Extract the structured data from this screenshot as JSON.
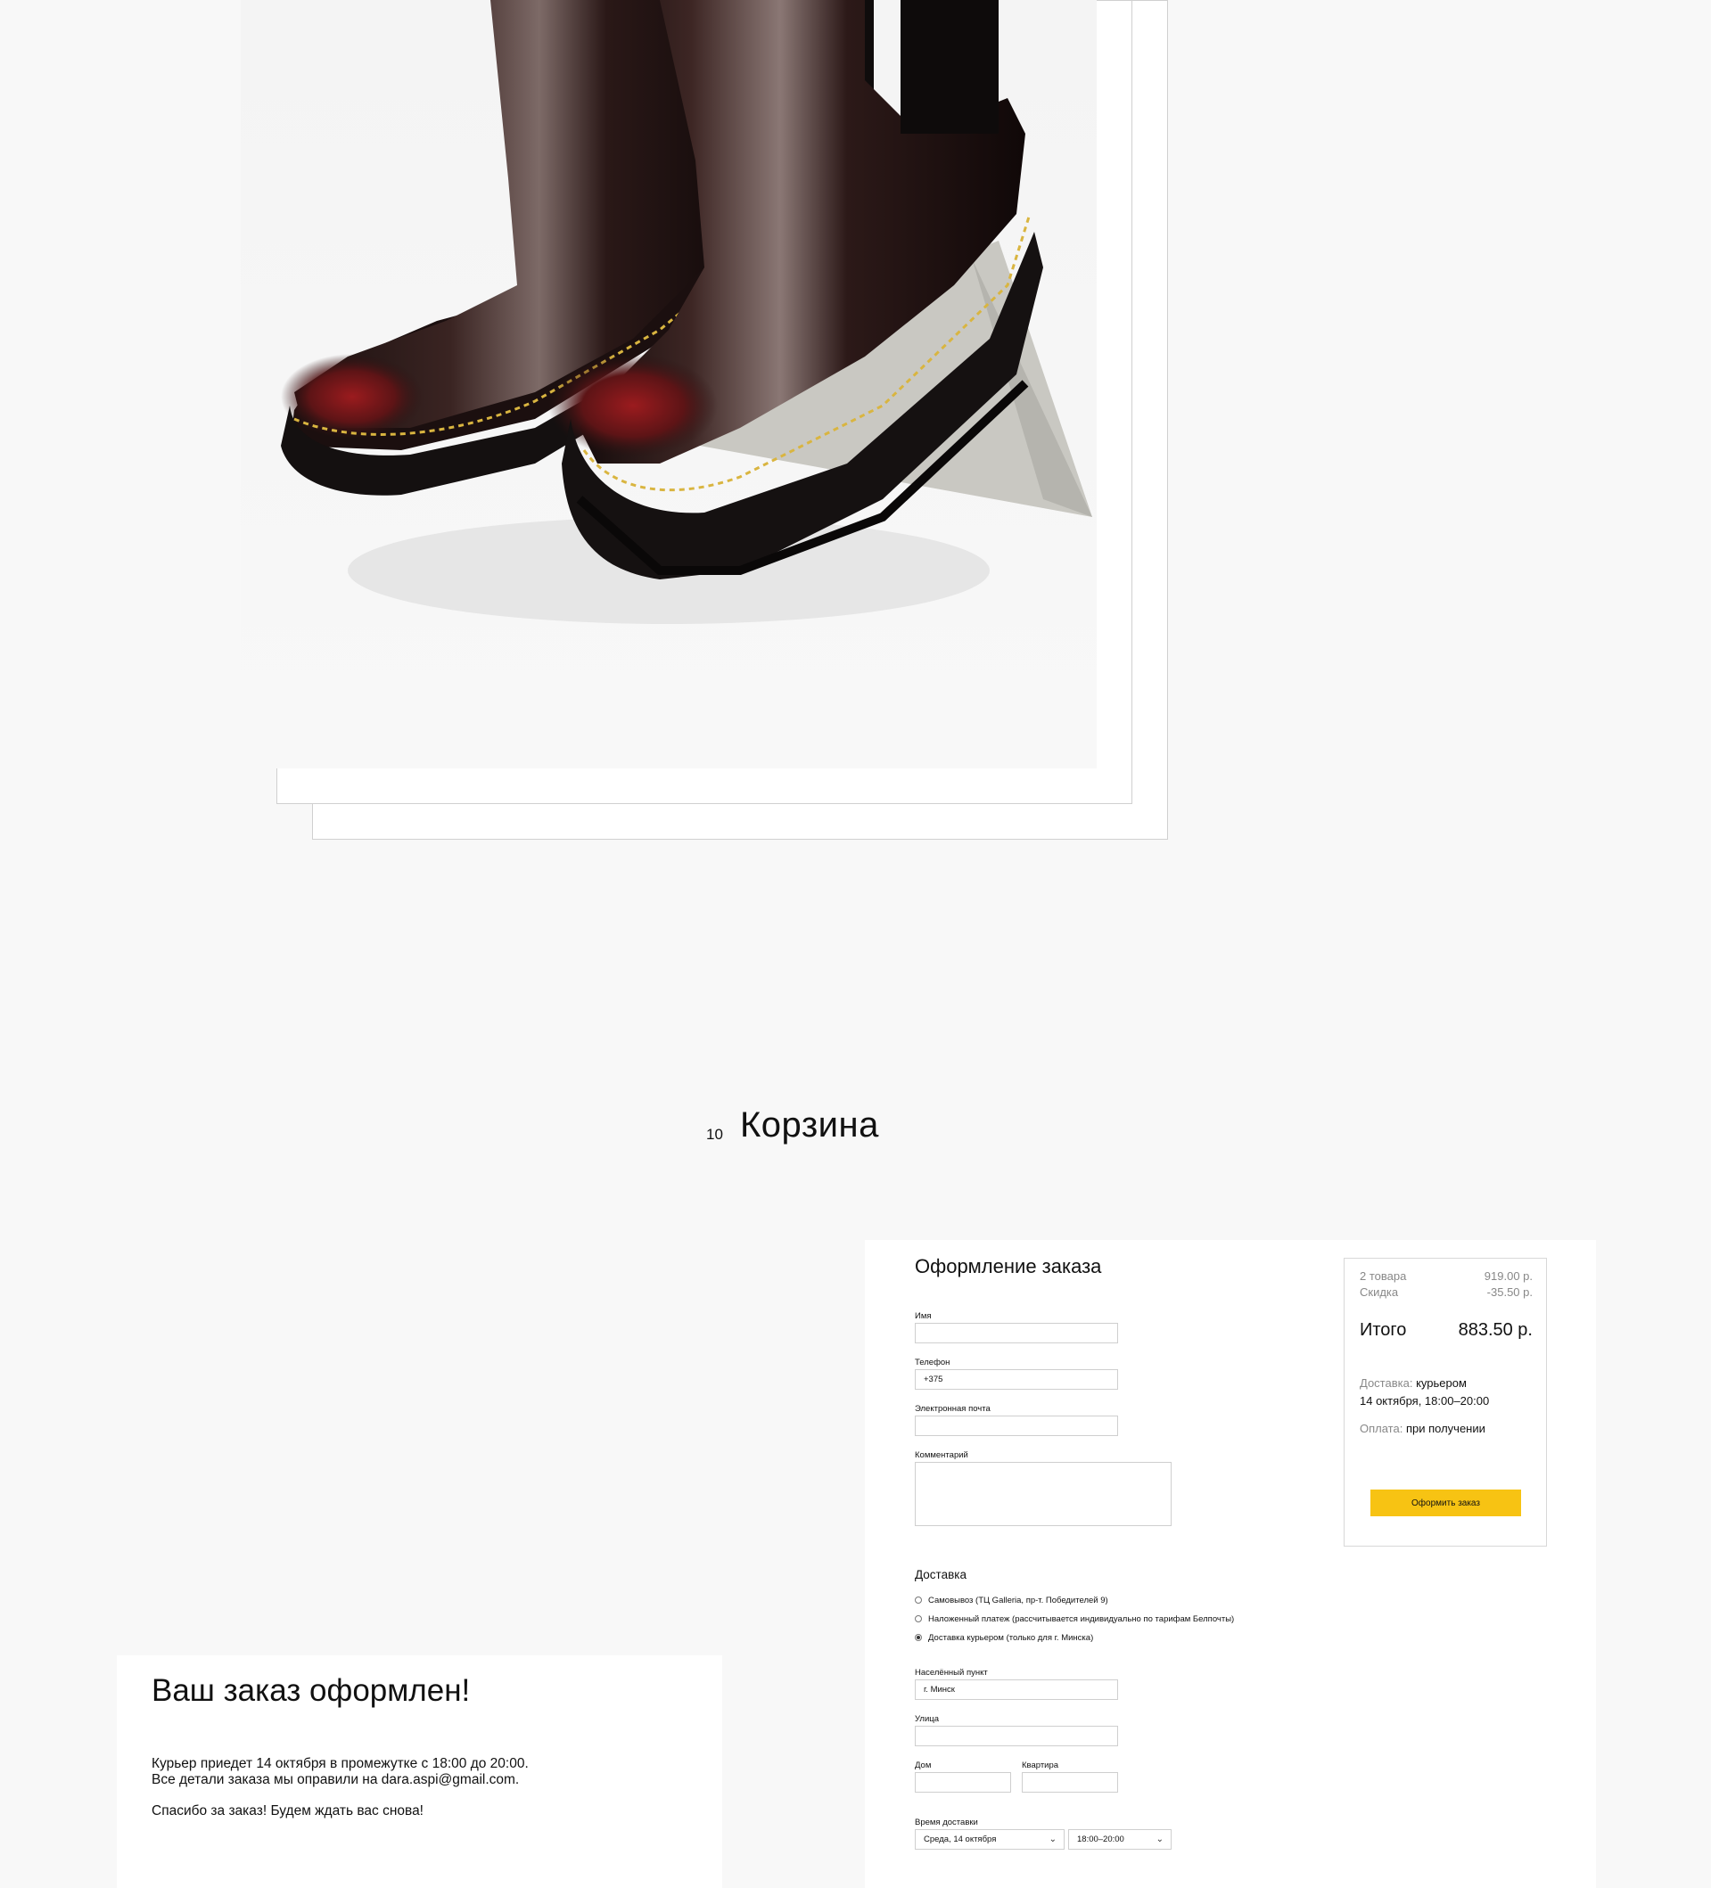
{
  "product": {
    "image": "black-leather-chelsea-boots-photo"
  },
  "section": {
    "number": "10",
    "title": "Корзина"
  },
  "confirmation": {
    "title": "Ваш заказ оформлен!",
    "line1": "Курьер приедет 14 октября в промежутке с 18:00 до 20:00.",
    "line2": "Все детали заказа мы оправили на dara.aspi@gmail.com.",
    "line3": "Спасибо за заказ! Будем ждать вас снова!"
  },
  "checkout": {
    "title": "Оформление заказа",
    "fields": {
      "name_label": "Имя",
      "name_value": "",
      "phone_label": "Телефон",
      "phone_value": "+375",
      "email_label": "Электронная почта",
      "email_value": "",
      "comment_label": "Комментарий",
      "comment_value": ""
    },
    "delivery": {
      "title": "Доставка",
      "options": [
        {
          "label": "Самовывоз (ТЦ Galleria,  пр-т. Победителей 9)",
          "selected": false
        },
        {
          "label": "Наложенный платеж (рассчитывается индивидуально по тарифам Белпочты)",
          "selected": false
        },
        {
          "label": "Доставка курьером (только для г. Минска)",
          "selected": true
        }
      ],
      "city_label": "Населённый пункт",
      "city_value": "г. Минск",
      "street_label": "Улица",
      "street_value": "",
      "house_label": "Дом",
      "house_value": "",
      "apartment_label": "Квартира",
      "apartment_value": "",
      "time_label": "Время доставки",
      "date_value": "Среда, 14 октября",
      "time_value": "18:00–20:00"
    },
    "summary": {
      "items_label": "2 товара",
      "items_value": "919.00 р.",
      "discount_label": "Скидка",
      "discount_value": "-35.50 р.",
      "total_label": "Итого",
      "total_value": "883.50 р.",
      "delivery_key": "Доставка:",
      "delivery_value": "курьером",
      "delivery_time": "14 октября, 18:00–20:00",
      "payment_key": "Оплата:",
      "payment_value": "при получении",
      "button": "Оформить заказ"
    }
  },
  "colors": {
    "accent": "#f7c313",
    "background": "#f8f8f8",
    "muted_text": "#888888"
  }
}
